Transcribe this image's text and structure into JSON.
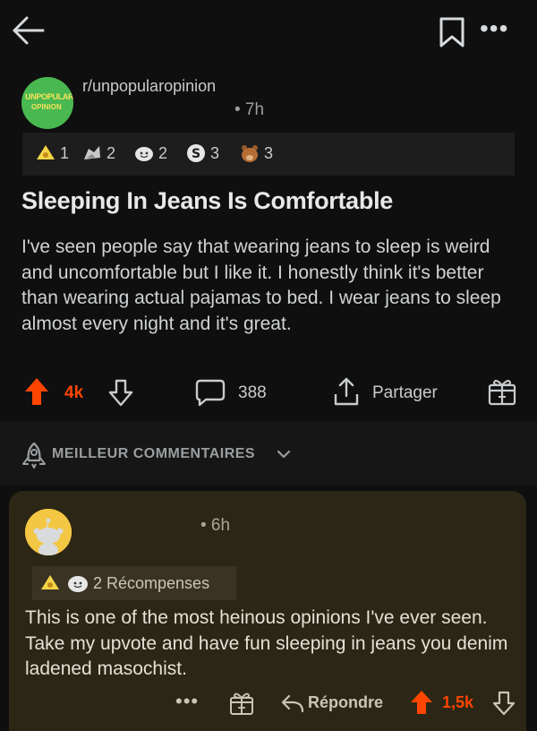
{
  "post": {
    "subreddit": "r/unpopularopinion",
    "subreddit_logo_text": [
      "UNPOPULAR",
      "OPINION"
    ],
    "time": "• 7h",
    "awards": [
      {
        "icon": "silver-cone-award-icon",
        "count": "1"
      },
      {
        "icon": "rocket-like-award-icon",
        "count": "2"
      },
      {
        "icon": "wholesome-award-icon",
        "count": "2"
      },
      {
        "icon": "take-my-energy-award-icon",
        "count": "3"
      },
      {
        "icon": "bear-award-icon",
        "count": "3"
      }
    ],
    "title": "Sleeping In Jeans Is Comfortable",
    "body": "I've seen people say that wearing jeans to sleep is weird and uncomfortable but I like it. I honestly think it's better than wearing actual pajamas to bed. I wear jeans to sleep almost every night and it's great.",
    "score": "4k",
    "comments": "388",
    "share_label": "Partager"
  },
  "sort_label": "MEILLEUR COMMENTAIRES",
  "comment": {
    "time": "• 6h",
    "awards_label": "2 Récompenses",
    "text": "This is one of the most heinous opinions I've ever seen. Take my upvote and have fun sleeping in jeans you denim ladened masochist.",
    "more": "•••",
    "reply_label": "Répondre",
    "score": "1,5k"
  },
  "colors": {
    "background": "#0f0f0f",
    "upvote": "#ff4500",
    "comment_bg": "#2c2616",
    "subreddit_logo": "#49b851"
  }
}
